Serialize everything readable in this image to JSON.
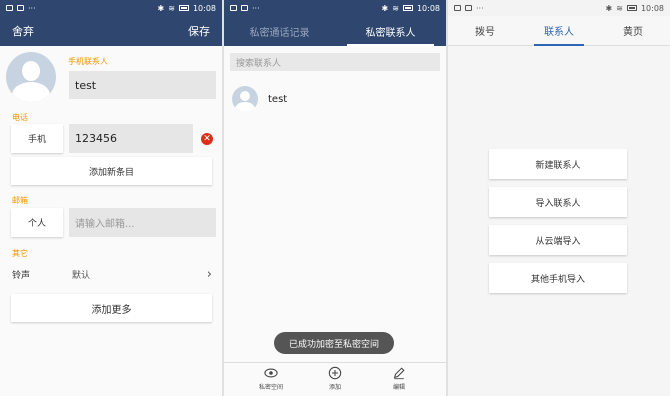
{
  "status_bar": {
    "time": "10:08"
  },
  "edit_panel": {
    "header": {
      "cancel": "舍弃",
      "save": "保存"
    },
    "private_contact_label": "手机联系人",
    "name_value": "test",
    "phone_section_label": "电话",
    "phone_type": "手机",
    "phone_value": "123456",
    "add_entry": "添加新条目",
    "email_section_label": "邮箱",
    "email_type": "个人",
    "email_placeholder": "请输入邮箱...",
    "other_section_label": "其它",
    "ringtone_label": "铃声",
    "ringtone_value": "默认",
    "add_more": "添加更多"
  },
  "private_panel": {
    "tabs": [
      {
        "label": "私密通话记录"
      },
      {
        "label": "私密联系人"
      }
    ],
    "search_placeholder": "搜索联系人",
    "contacts": [
      {
        "name": "test"
      }
    ],
    "toast": "已成功加密至私密空间",
    "bottom_actions": [
      {
        "label": "私密空间",
        "icon": "eye-icon"
      },
      {
        "label": "添加",
        "icon": "plus-circle-icon"
      },
      {
        "label": "编辑",
        "icon": "pencil-icon"
      }
    ]
  },
  "contacts_panel": {
    "tabs": [
      {
        "label": "拨号"
      },
      {
        "label": "联系人"
      },
      {
        "label": "黄页"
      }
    ],
    "actions": [
      "新建联系人",
      "导入联系人",
      "从云端导入",
      "其他手机导入"
    ]
  },
  "colors": {
    "header": "#2f466e",
    "accent_orange": "#f39700",
    "accent_blue": "#2f66b3",
    "delete_red": "#d9301c"
  }
}
